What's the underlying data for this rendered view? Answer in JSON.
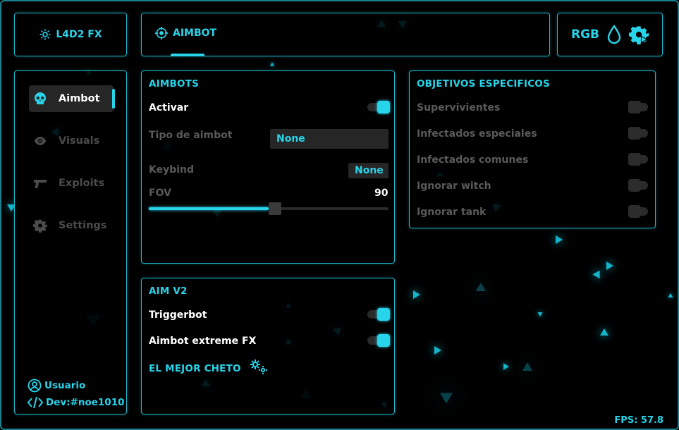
{
  "brand": {
    "title": "L4D2 FX"
  },
  "tabs": [
    {
      "label": "AIMBOT",
      "active": true
    }
  ],
  "topbar": {
    "rgb_label": "RGB"
  },
  "sidebar": {
    "items": [
      {
        "label": "Aimbot",
        "icon": "skull-icon",
        "active": true
      },
      {
        "label": "Visuals",
        "icon": "eye-icon",
        "active": false
      },
      {
        "label": "Exploits",
        "icon": "gun-icon",
        "active": false
      },
      {
        "label": "Settings",
        "icon": "gear-icon",
        "active": false
      }
    ],
    "user": "Usuario",
    "dev": "Dev:#noe1010"
  },
  "aimbots": {
    "title": "AIMBOTS",
    "activar": {
      "label": "Activar",
      "on": true
    },
    "tipo": {
      "label": "Tipo de aimbot",
      "value": "None"
    },
    "keybind": {
      "label": "Keybind",
      "value": "None"
    },
    "fov": {
      "label": "FOV",
      "value": "90",
      "fraction": 0.5
    }
  },
  "objetivos": {
    "title": "OBJETIVOS ESPECIFICOS",
    "items": [
      {
        "label": "Supervivientes",
        "on": false
      },
      {
        "label": "Infectados especiales",
        "on": false
      },
      {
        "label": "Infectados comunes",
        "on": false
      },
      {
        "label": "Ignorar witch",
        "on": false
      },
      {
        "label": "Ignorar tank",
        "on": false
      }
    ]
  },
  "aimv2": {
    "title": "AIM V2",
    "triggerbot": {
      "label": "Triggerbot",
      "on": true
    },
    "extreme": {
      "label": "Aimbot extreme FX",
      "on": true
    },
    "footer": "EL MEJOR CHETO"
  },
  "status": {
    "fps": "FPS: 57.8"
  },
  "colors": {
    "accent": "#27d4ea",
    "background": "#000000",
    "panel_border": "#1fb9cf"
  }
}
